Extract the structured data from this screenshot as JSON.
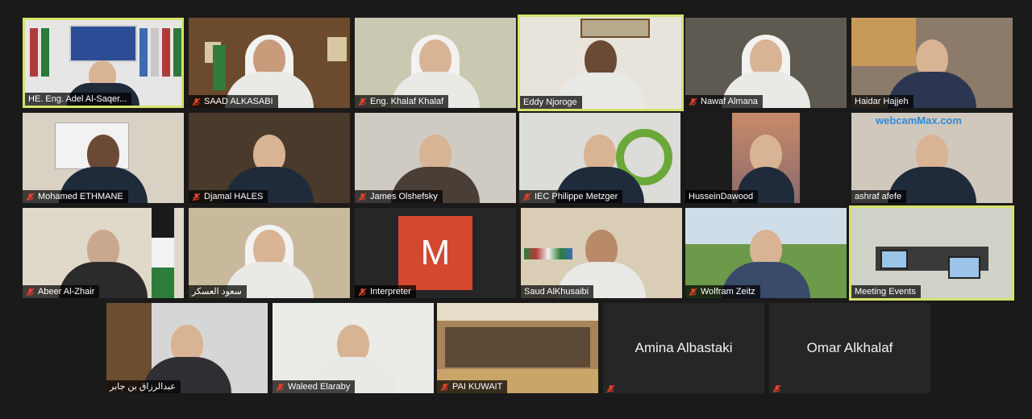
{
  "colors": {
    "background": "#1a1a1a",
    "active_border": "#d6e26b",
    "avatar_m": "#d3482f",
    "mic_muted": "#e8412c"
  },
  "participants": [
    {
      "name": "HE. Eng. Adel Al-Saqer...",
      "muted": false,
      "active": true
    },
    {
      "name": "SAAD ALKASABI",
      "muted": true
    },
    {
      "name": "Eng. Khalaf Khalaf",
      "muted": true
    },
    {
      "name": "Eddy Njoroge",
      "muted": false,
      "active": true
    },
    {
      "name": "Nawaf Almana",
      "muted": true
    },
    {
      "name": "Haidar Hajjeh",
      "muted": false
    },
    {
      "name": "Mohamed ETHMANE",
      "muted": true
    },
    {
      "name": "Djamal HALES",
      "muted": true
    },
    {
      "name": "James Olshefsky",
      "muted": true
    },
    {
      "name": "IEC Philippe Metzger",
      "muted": true
    },
    {
      "name": "HusseinDawood",
      "muted": false
    },
    {
      "name": "ashraf afefe",
      "muted": false,
      "overlay_text": "webcamMax.com"
    },
    {
      "name": "Abeer Al-Zhair",
      "muted": true
    },
    {
      "name": "سعود العسكر",
      "muted": false
    },
    {
      "name": "Interpreter",
      "muted": true,
      "avatar_letter": "M"
    },
    {
      "name": "Saud AlKhusaibi",
      "muted": false
    },
    {
      "name": "Wolfram Zeitz",
      "muted": true
    },
    {
      "name": "Meeting Events",
      "muted": false,
      "active": true
    },
    {
      "name": "عبدالرزاق بن جابر",
      "muted": false
    },
    {
      "name": "Waleed Elaraby",
      "muted": true
    },
    {
      "name": "PAI KUWAIT",
      "muted": true
    },
    {
      "name": "Amina Albastaki",
      "muted": true,
      "video_off": true
    },
    {
      "name": "Omar Alkhalaf",
      "muted": true,
      "video_off": true
    }
  ]
}
